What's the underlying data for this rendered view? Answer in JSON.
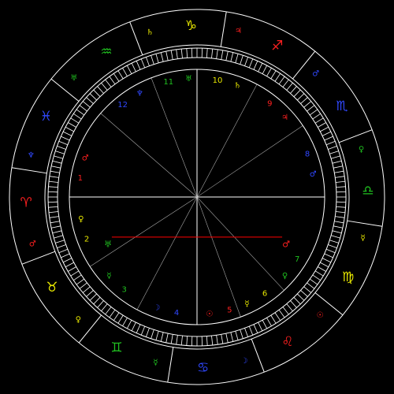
{
  "colors": {
    "background": "#000000",
    "lines": "#ffffff",
    "house_lines": "#a8a8a8",
    "fire": "#ff2020",
    "earth": "#e8e800",
    "air": "#20c020",
    "water": "#3048ff",
    "aspect_line": "#ff0000"
  },
  "signs": [
    {
      "name": "aries",
      "glyph": "♈",
      "element": "fire"
    },
    {
      "name": "taurus",
      "glyph": "♉",
      "element": "earth"
    },
    {
      "name": "gemini",
      "glyph": "♊",
      "element": "air"
    },
    {
      "name": "cancer",
      "glyph": "♋",
      "element": "water"
    },
    {
      "name": "leo",
      "glyph": "♌",
      "element": "fire"
    },
    {
      "name": "virgo",
      "glyph": "♍",
      "element": "earth"
    },
    {
      "name": "libra",
      "glyph": "♎",
      "element": "air"
    },
    {
      "name": "scorpio",
      "glyph": "♏",
      "element": "water"
    },
    {
      "name": "sagittarius",
      "glyph": "♐",
      "element": "fire"
    },
    {
      "name": "capricorn",
      "glyph": "♑",
      "element": "earth"
    },
    {
      "name": "aquarius",
      "glyph": "♒",
      "element": "air"
    },
    {
      "name": "pisces",
      "glyph": "♓",
      "element": "water"
    }
  ],
  "sign_rulers": [
    {
      "sign": "aries",
      "glyph": "♂",
      "element": "fire"
    },
    {
      "sign": "taurus",
      "glyph": "♀",
      "element": "earth"
    },
    {
      "sign": "gemini",
      "glyph": "☿",
      "element": "air"
    },
    {
      "sign": "cancer",
      "glyph": "☽",
      "element": "water"
    },
    {
      "sign": "leo",
      "glyph": "☉",
      "element": "fire"
    },
    {
      "sign": "virgo",
      "glyph": "☿",
      "element": "earth"
    },
    {
      "sign": "libra",
      "glyph": "♀",
      "element": "air"
    },
    {
      "sign": "scorpio",
      "glyph": "♂",
      "element": "water"
    },
    {
      "sign": "sagittarius",
      "glyph": "♃",
      "element": "fire"
    },
    {
      "sign": "capricorn",
      "glyph": "♄",
      "element": "earth"
    },
    {
      "sign": "aquarius",
      "glyph": "♅",
      "element": "air"
    },
    {
      "sign": "pisces",
      "glyph": "♆",
      "element": "water"
    }
  ],
  "houses": [
    {
      "number": "1",
      "element": "fire",
      "ruler": "♂"
    },
    {
      "number": "2",
      "element": "earth",
      "ruler": "♀"
    },
    {
      "number": "3",
      "element": "air",
      "ruler": "☿"
    },
    {
      "number": "4",
      "element": "water",
      "ruler": "☽"
    },
    {
      "number": "5",
      "element": "fire",
      "ruler": "☉"
    },
    {
      "number": "6",
      "element": "earth",
      "ruler": "☿"
    },
    {
      "number": "7",
      "element": "air",
      "ruler": "♀"
    },
    {
      "number": "8",
      "element": "water",
      "ruler": "♂"
    },
    {
      "number": "9",
      "element": "fire",
      "ruler": "♃"
    },
    {
      "number": "10",
      "element": "earth",
      "ruler": "♄"
    },
    {
      "number": "11",
      "element": "air",
      "ruler": "♅"
    },
    {
      "number": "12",
      "element": "water",
      "ruler": "♆"
    }
  ],
  "planets": [
    {
      "name": "uranus",
      "glyph": "♅",
      "element": "air"
    },
    {
      "name": "mars",
      "glyph": "♂",
      "element": "fire"
    }
  ]
}
